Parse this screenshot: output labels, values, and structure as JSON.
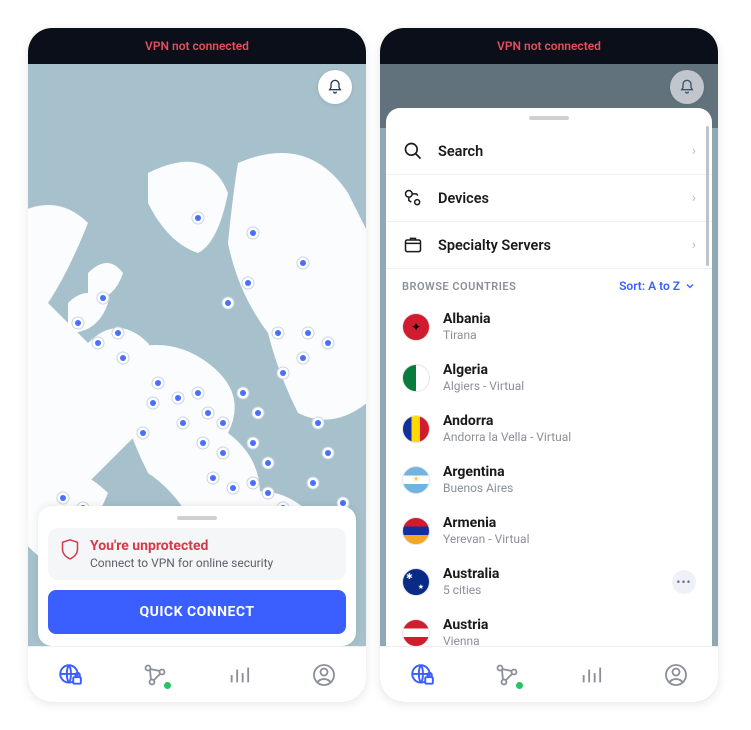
{
  "status_text": "VPN not connected",
  "alert": {
    "title": "You're unprotected",
    "subtitle": "Connect to VPN for online security"
  },
  "quick_connect_label": "QUICK CONNECT",
  "menu": {
    "search": "Search",
    "devices": "Devices",
    "specialty": "Specialty Servers"
  },
  "section": {
    "title": "BROWSE COUNTRIES",
    "sort_label": "Sort: A to Z"
  },
  "countries": [
    {
      "name": "Albania",
      "sub": "Tirana",
      "flag_bg": "#d01c2e",
      "flag_fg": "#000"
    },
    {
      "name": "Algeria",
      "sub": "Algiers - Virtual",
      "flag_bg": "linear-gradient(90deg,#0a7a3d 50%,#fff 50%)",
      "flag_fg": "#d01c2e"
    },
    {
      "name": "Andorra",
      "sub": "Andorra la Vella - Virtual",
      "flag_bg": "linear-gradient(90deg,#1030a0 33%,#ffd900 33% 66%,#d01c2e 66%)",
      "flag_fg": ""
    },
    {
      "name": "Argentina",
      "sub": "Buenos Aires",
      "flag_bg": "linear-gradient(#6fb3e0 33%,#fff 33% 66%,#6fb3e0 66%)",
      "flag_fg": "#f5c542"
    },
    {
      "name": "Armenia",
      "sub": "Yerevan - Virtual",
      "flag_bg": "linear-gradient(#d01c2e 33%,#1030a0 33% 66%,#f5a623 66%)",
      "flag_fg": ""
    },
    {
      "name": "Australia",
      "sub": "5 cities",
      "flag_bg": "#0a2a88",
      "flag_fg": "#fff",
      "has_more": true
    },
    {
      "name": "Austria",
      "sub": "Vienna",
      "flag_bg": "linear-gradient(#d01c2e 33%,#fff 33% 66%,#d01c2e 66%)",
      "flag_fg": ""
    }
  ]
}
